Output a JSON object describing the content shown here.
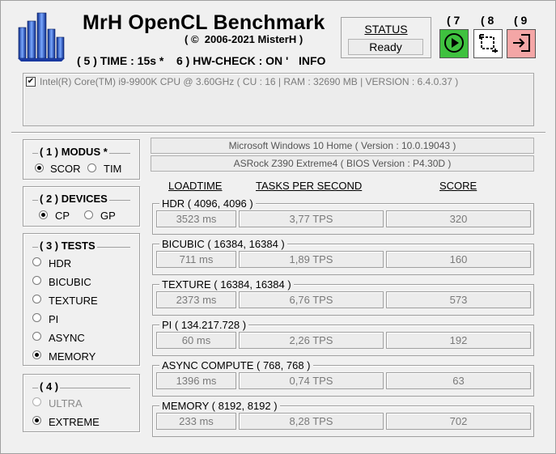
{
  "header": {
    "title": "MrH OpenCL Benchmark",
    "copyright": "( ©  2006-2021 MisterH )",
    "options": [
      {
        "label": "( 5 ) TIME : 15s *"
      },
      {
        "label": "6 ) HW-CHECK : ON '"
      },
      {
        "label": "INFO"
      }
    ]
  },
  "status": {
    "label": "STATUS",
    "value": "Ready"
  },
  "toolbar": {
    "buttons": [
      {
        "number": "( 7",
        "icon": "play-icon",
        "color": "#3fc13f"
      },
      {
        "number": "( 8",
        "icon": "region-select-icon",
        "color": "#ffffff"
      },
      {
        "number": "( 9",
        "icon": "exit-icon",
        "color": "#f4a6a6"
      }
    ]
  },
  "system": {
    "checked": true,
    "text": "Intel(R) Core(TM) i9-9900K CPU @ 3.60GHz ( CU : 16 | RAM : 32690 MB | VERSION : 6.4.0.37 )",
    "os": "Microsoft Windows 10 Home ( Version : 10.0.19043 )",
    "board": "ASRock Z390 Extreme4 ( BIOS Version : P4.30D )"
  },
  "modus": {
    "title": "( 1 ) MODUS *",
    "options": [
      {
        "label": "SCOR",
        "selected": true
      },
      {
        "label": "TIM",
        "selected": false
      }
    ]
  },
  "devices": {
    "title": "( 2 ) DEVICES",
    "options": [
      {
        "label": "CP",
        "selected": true
      },
      {
        "label": "GP",
        "selected": false
      }
    ]
  },
  "tests": {
    "title": "( 3 ) TESTS",
    "options": [
      {
        "label": "HDR",
        "selected": false
      },
      {
        "label": "BICUBIC",
        "selected": false
      },
      {
        "label": "TEXTURE",
        "selected": false
      },
      {
        "label": "PI",
        "selected": false
      },
      {
        "label": "ASYNC",
        "selected": false
      },
      {
        "label": "MEMORY",
        "selected": true
      }
    ]
  },
  "level": {
    "title": "( 4 )",
    "options": [
      {
        "label": "ULTRA",
        "selected": false,
        "disabled": true
      },
      {
        "label": "EXTREME",
        "selected": true,
        "disabled": false
      }
    ]
  },
  "results": {
    "columns": {
      "load": "LOADTIME",
      "tps": "TASKS PER SECOND",
      "score": "SCORE"
    },
    "rows": [
      {
        "name": "HDR ( 4096, 4096 )",
        "load": "3523 ms",
        "tps": "3,77 TPS",
        "score": "320"
      },
      {
        "name": "BICUBIC ( 16384, 16384 )",
        "load": "711 ms",
        "tps": "1,89 TPS",
        "score": "160"
      },
      {
        "name": "TEXTURE ( 16384, 16384 )",
        "load": "2373 ms",
        "tps": "6,76 TPS",
        "score": "573"
      },
      {
        "name": "PI ( 134.217.728 )",
        "load": "60 ms",
        "tps": "2,26 TPS",
        "score": "192"
      },
      {
        "name": "ASYNC COMPUTE ( 768, 768 )",
        "load": "1396 ms",
        "tps": "0,74 TPS",
        "score": "63"
      },
      {
        "name": "MEMORY ( 8192, 8192 )",
        "load": "233 ms",
        "tps": "8,28 TPS",
        "score": "702"
      }
    ]
  }
}
